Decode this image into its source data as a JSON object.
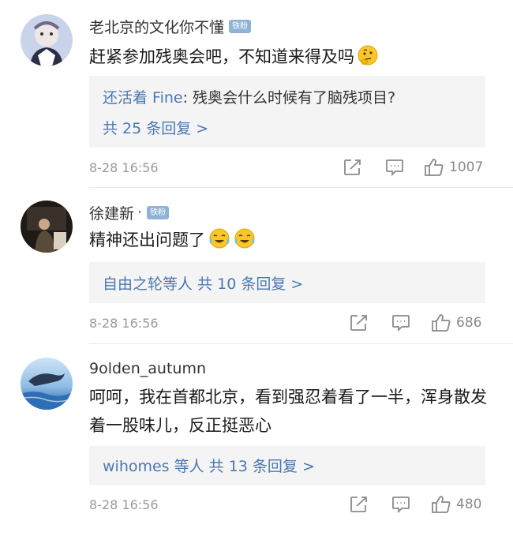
{
  "comments": [
    {
      "username": "老北京的文化你不懂",
      "badge": "铁粉",
      "text": "赶紧参加残奥会吧，不知道来得及吗",
      "reply_user": "还活着 Fine",
      "reply_text": ": 残奥会什么时候有了脑残项目?",
      "reply_more": "共 25 条回复 >",
      "time": "8-28 16:56",
      "likes": "1007"
    },
    {
      "username": "徐建新",
      "dot": "·",
      "badge": "铁粉",
      "text": "精神还出问题了",
      "reply_user": "自由之轮等人",
      "reply_more": "共 10 条回复 >",
      "time": "8-28 16:56",
      "likes": "686"
    },
    {
      "username": "9olden_autumn",
      "text": "呵呵，我在首都北京，看到强忍着看了一半，浑身散发着一股味儿，反正挺恶心",
      "reply_user": "wihomes 等人",
      "reply_more": "共 13 条回复 >",
      "time": "8-28 16:56",
      "likes": "480"
    }
  ],
  "icons": {
    "share": "share-icon",
    "comment": "comment-icon",
    "like": "thumbs-up-icon",
    "emoji_think": "thinking-face-emoji",
    "emoji_cry": "laughing-tears-emoji"
  },
  "colors": {
    "link": "#4a77b3",
    "badge": "#8fb3d6",
    "reply_bg": "#f4f4f4",
    "meta": "#9a9a9a"
  }
}
